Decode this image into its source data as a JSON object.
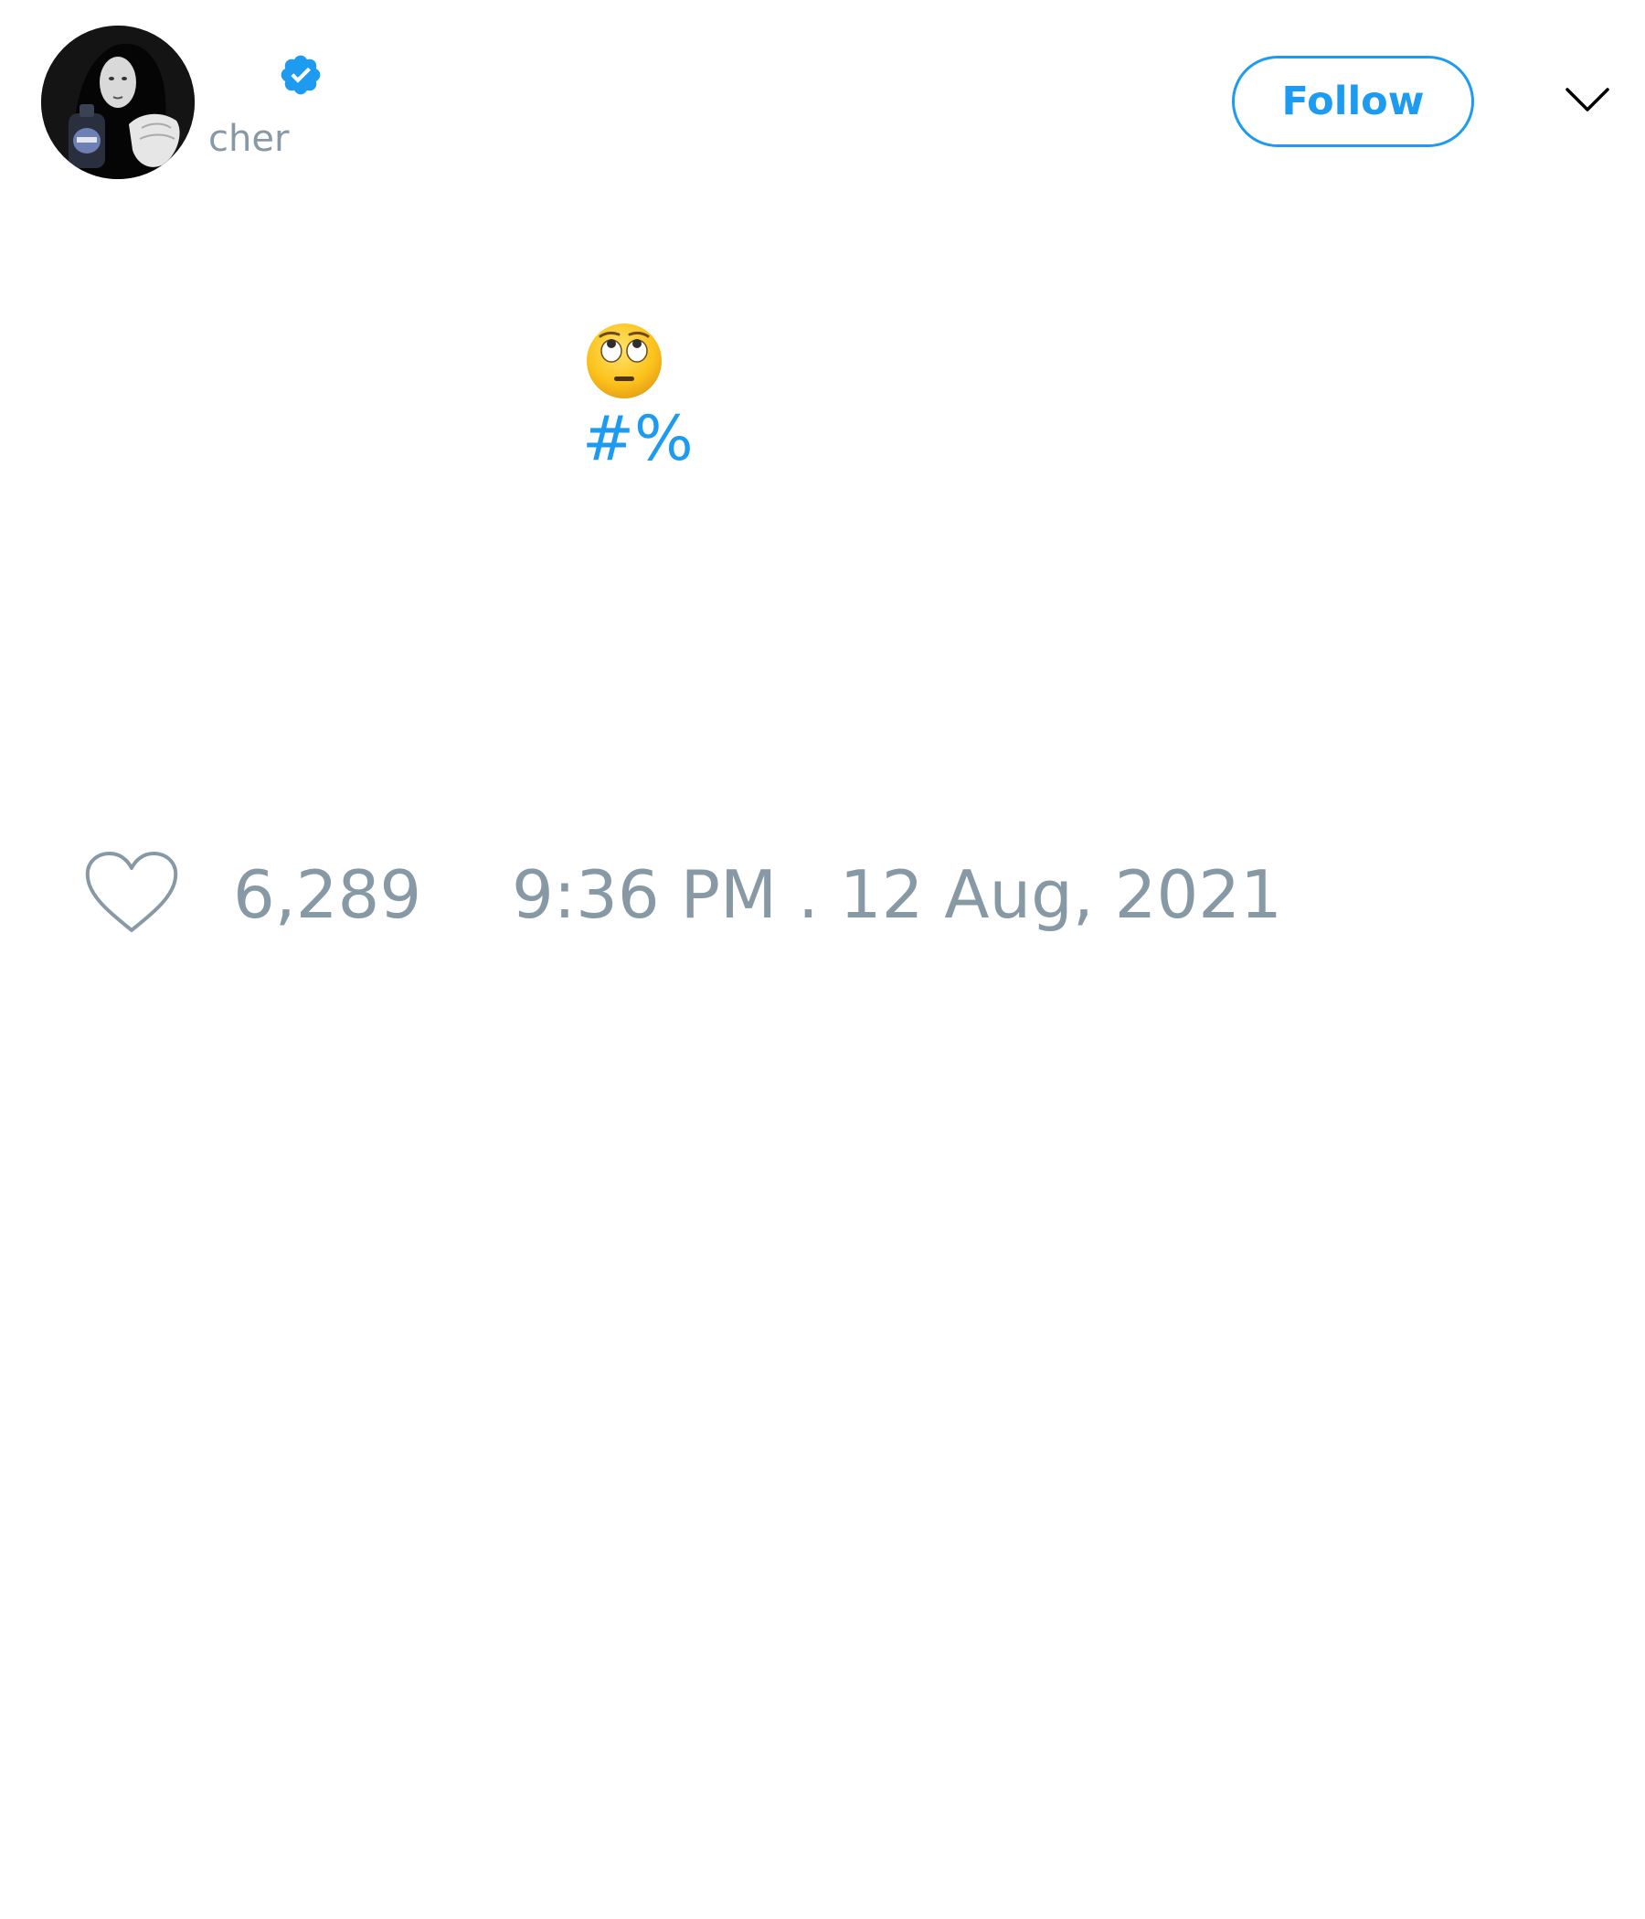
{
  "author": {
    "handle": "cher",
    "verified": true
  },
  "header": {
    "follow_label": "Follow"
  },
  "tweet": {
    "emoji": "face-with-rolling-eyes",
    "hashtag": "#%"
  },
  "footer": {
    "like_count": "6,289",
    "timestamp": "9:36 PM . 12 Aug, 2021"
  },
  "icons": {
    "verified": "verified-badge-icon",
    "menu": "chevron-down-icon",
    "like": "heart-icon"
  },
  "colors": {
    "accent": "#1d9bf0",
    "muted_text": "#8899a6",
    "background": "#ffffff"
  }
}
